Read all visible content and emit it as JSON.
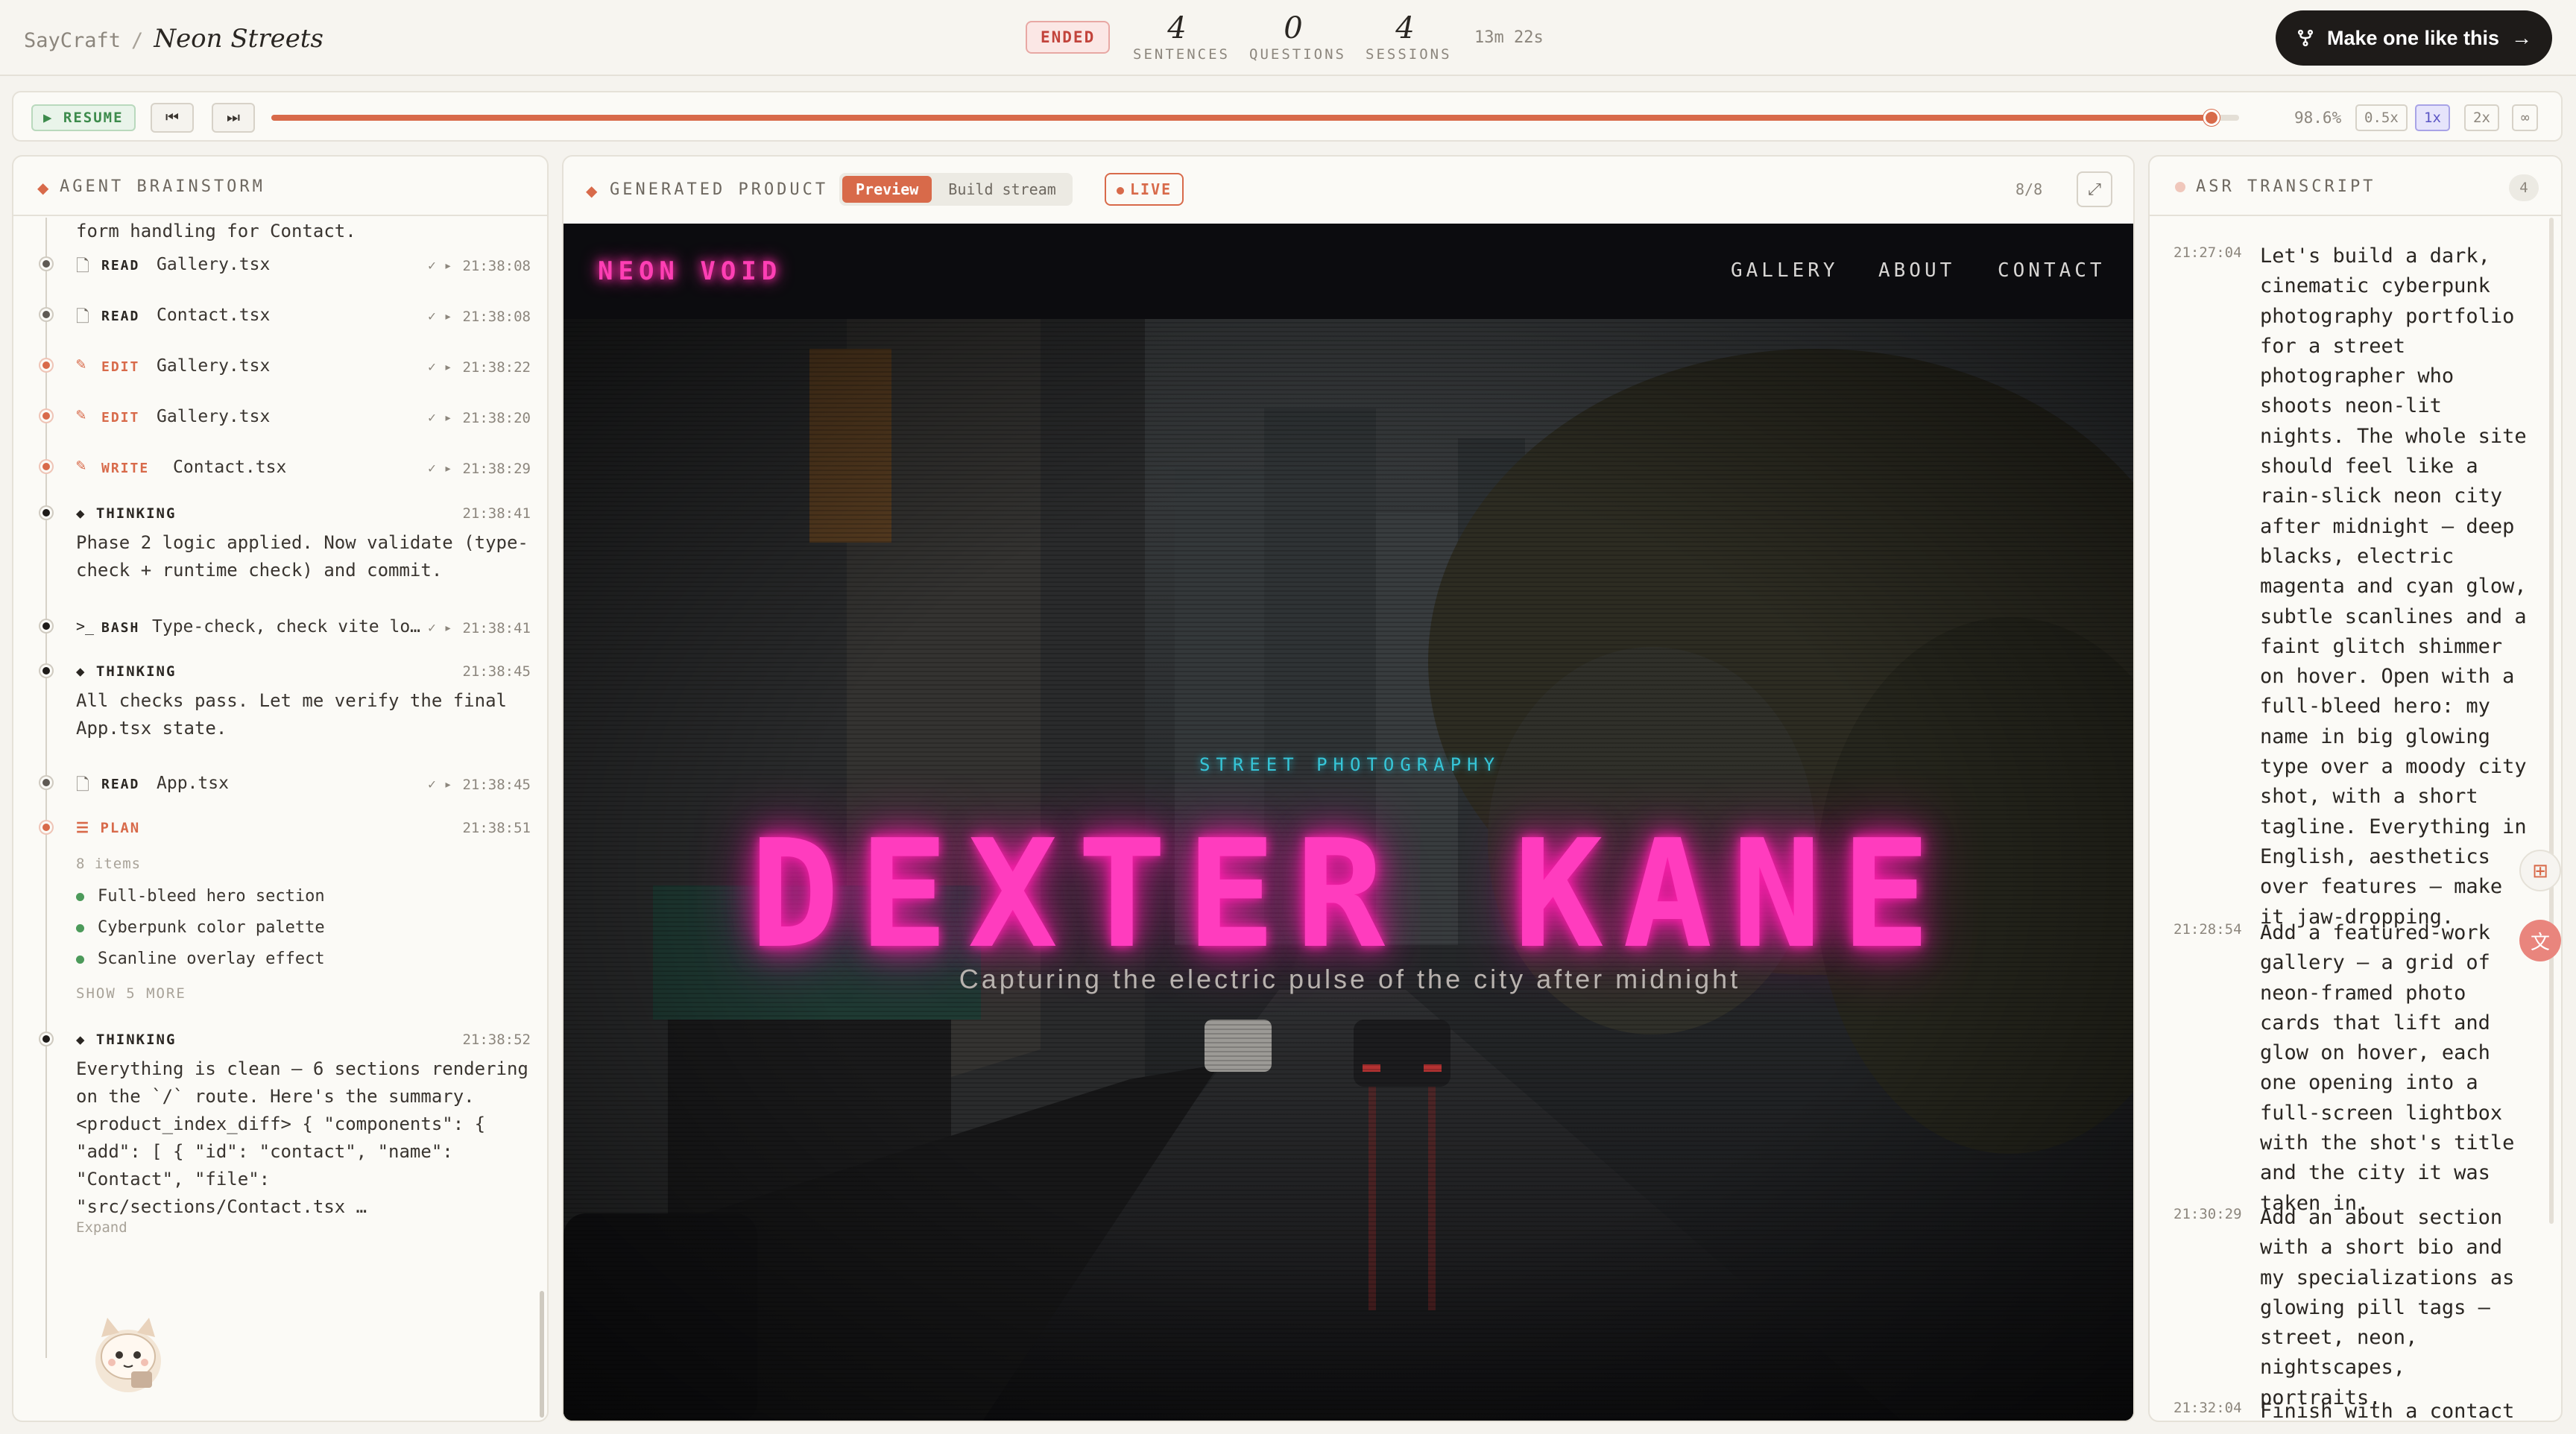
{
  "header": {
    "brand": "SayCraft",
    "separator": "/",
    "project": "Neon Streets",
    "status": "ENDED",
    "stats": [
      {
        "value": "4",
        "label": "SENTENCES"
      },
      {
        "value": "0",
        "label": "QUESTIONS"
      },
      {
        "value": "4",
        "label": "SESSIONS"
      }
    ],
    "duration": "13m 22s",
    "make_button": "Make one like this"
  },
  "playback": {
    "resume": "▶ RESUME",
    "prev_icon": "⏮",
    "next_icon": "⏭",
    "progress": 0.986,
    "progress_label": "98.6%",
    "speeds": [
      {
        "label": "0.5x",
        "active": false
      },
      {
        "label": "1x",
        "active": true
      },
      {
        "label": "2x",
        "active": false
      },
      {
        "label": "∞",
        "active": false
      }
    ]
  },
  "brainstorm": {
    "title": "AGENT BRAINSTORM",
    "clipped_text": "form handling for Contact.",
    "entries": [
      {
        "type": "tool",
        "kind": "READ",
        "file": "Gallery.tsx",
        "status": "✓ ▸",
        "time": "21:38:08",
        "dot": "gray"
      },
      {
        "type": "tool",
        "kind": "READ",
        "file": "Contact.tsx",
        "status": "✓ ▸",
        "time": "21:38:08",
        "dot": "gray"
      },
      {
        "type": "tool",
        "kind": "EDIT",
        "file": "Gallery.tsx",
        "status": "✓ ▸",
        "time": "21:38:22",
        "dot": "orange"
      },
      {
        "type": "tool",
        "kind": "EDIT",
        "file": "Gallery.tsx",
        "status": "✓ ▸",
        "time": "21:38:20",
        "dot": "orange"
      },
      {
        "type": "tool",
        "kind": "WRITE",
        "file": "Contact.tsx",
        "status": "✓ ▸",
        "time": "21:38:29",
        "dot": "orange"
      },
      {
        "type": "thinking",
        "kind": "THINKING",
        "time": "21:38:41",
        "text": "Phase 2 logic applied. Now validate (type-check + runtime check) and commit."
      },
      {
        "type": "tool",
        "kind": "BASH",
        "file": "Type-check, check vite lo…",
        "status": "✓ ▸",
        "time": "21:38:41",
        "dot": "black"
      },
      {
        "type": "thinking",
        "kind": "THINKING",
        "time": "21:38:45",
        "text": "All checks pass. Let me verify the final App.tsx state."
      },
      {
        "type": "tool",
        "kind": "READ",
        "file": "App.tsx",
        "status": "✓ ▸",
        "time": "21:38:45",
        "dot": "gray"
      },
      {
        "type": "plan",
        "kind": "PLAN",
        "time": "21:38:51",
        "count": "8 items",
        "items": [
          "Full-bleed hero section",
          "Cyberpunk color palette",
          "Scanline overlay effect"
        ],
        "more": "SHOW 5 MORE"
      },
      {
        "type": "thinking",
        "kind": "THINKING",
        "time": "21:38:52",
        "text": "Everything is clean — 6 sections rendering on the `/` route. Here's the summary. <product_index_diff> { \"components\": { \"add\": [ { \"id\": \"contact\", \"name\": \"Contact\", \"file\": \"src/sections/Contact.tsx …",
        "expand": "Expand"
      }
    ]
  },
  "product": {
    "title": "GENERATED PRODUCT",
    "tabs": [
      {
        "label": "Preview",
        "active": true
      },
      {
        "label": "Build stream",
        "active": false
      }
    ],
    "live": "LIVE",
    "page_count": "8/8",
    "site": {
      "logo": "NEON VOID",
      "nav": [
        "GALLERY",
        "ABOUT",
        "CONTACT"
      ],
      "kicker": "STREET PHOTOGRAPHY",
      "name": "DEXTER KANE",
      "tagline": "Capturing the electric pulse of the city after midnight"
    }
  },
  "transcript": {
    "title": "ASR TRANSCRIPT",
    "count": "4",
    "items": [
      {
        "time": "21:27:04",
        "text": "Let's build a dark, cinematic cyberpunk photography portfolio for a street photographer who shoots neon-lit nights. The whole site should feel like a rain-slick neon city after midnight — deep blacks, electric magenta and cyan glow, subtle scanlines and a faint glitch shimmer on hover. Open with a full-bleed hero: my name in big glowing type over a moody city shot, with a short tagline. Everything in English, aesthetics over features — make it jaw-dropping."
      },
      {
        "time": "21:28:54",
        "text": "Add a featured-work gallery — a grid of neon-framed photo cards that lift and glow on hover, each one opening into a full-screen lightbox with the shot's title and the city it was taken in."
      },
      {
        "time": "21:30:29",
        "text": "Add an about section with a short bio and my specializations as glowing pill tags — street, neon, nightscapes, portraits."
      },
      {
        "time": "21:32:04",
        "text": "Finish with a contact"
      }
    ]
  },
  "colors": {
    "accent": "#d86a4a",
    "neon_magenta": "#ff3cbe",
    "neon_cyan": "#36c6d8",
    "ended_red": "#c2433b",
    "resume_green": "#3d8b4c"
  }
}
